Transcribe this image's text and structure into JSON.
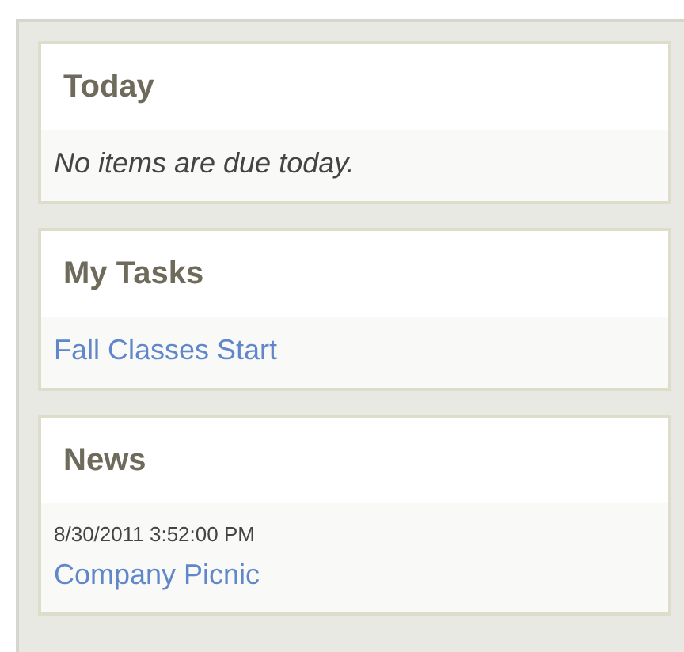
{
  "panels": [
    {
      "title": "Today",
      "items": [
        {
          "kind": "note",
          "text": "No items are due today."
        }
      ]
    },
    {
      "title": "My Tasks",
      "items": [
        {
          "kind": "link",
          "text": "Fall Classes Start"
        }
      ]
    },
    {
      "title": "News",
      "items": [
        {
          "kind": "news",
          "date": "8/30/2011 3:52:00 PM",
          "text": "Company Picnic"
        }
      ]
    }
  ]
}
